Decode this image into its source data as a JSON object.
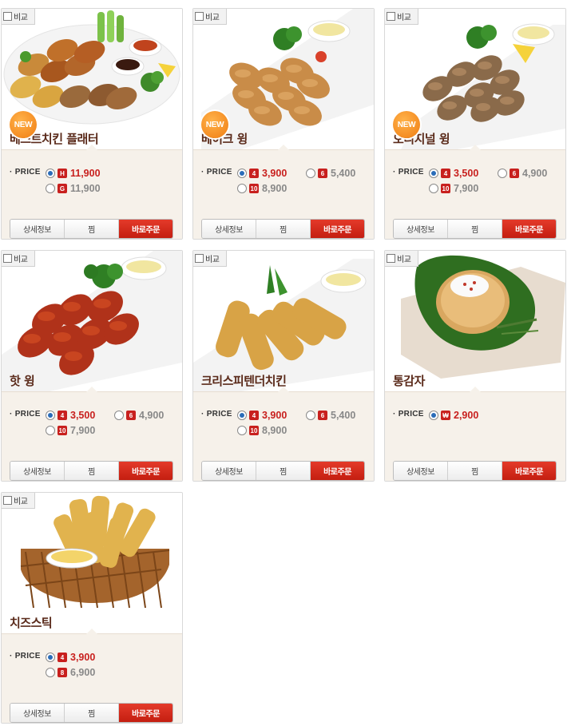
{
  "compare_label": "비교",
  "price_label": "· PRICE",
  "new_label": "NEW",
  "buttons": {
    "detail": "상세정보",
    "wish": "찜",
    "order": "바로주문"
  },
  "colors": {
    "accent": "#c8201e",
    "title": "#5a2a1a",
    "panel": "#f6f1ea",
    "new_badge": "#f07d12"
  },
  "products": [
    {
      "title": "베스트치킨 플래터",
      "is_new": true,
      "icon": "chicken-platter-photo",
      "options": [
        {
          "size": "H",
          "price": "11,900",
          "checked": true
        },
        {
          "size": "G",
          "price": "11,900",
          "checked": false
        }
      ]
    },
    {
      "title": "베이크 윙",
      "is_new": true,
      "icon": "baked-wings-photo",
      "options": [
        {
          "size": "4",
          "price": "3,900",
          "checked": true
        },
        {
          "size": "6",
          "price": "5,400",
          "checked": false
        },
        {
          "size": "10",
          "price": "8,900",
          "checked": false
        }
      ]
    },
    {
      "title": "오리지널 윙",
      "is_new": true,
      "icon": "original-wings-photo",
      "options": [
        {
          "size": "4",
          "price": "3,500",
          "checked": true
        },
        {
          "size": "6",
          "price": "4,900",
          "checked": false
        },
        {
          "size": "10",
          "price": "7,900",
          "checked": false
        }
      ]
    },
    {
      "title": "핫 윙",
      "is_new": false,
      "icon": "hot-wings-photo",
      "options": [
        {
          "size": "4",
          "price": "3,500",
          "checked": true
        },
        {
          "size": "6",
          "price": "4,900",
          "checked": false
        },
        {
          "size": "10",
          "price": "7,900",
          "checked": false
        }
      ]
    },
    {
      "title": "크리스피텐더치킨",
      "is_new": false,
      "icon": "crispy-tender-photo",
      "options": [
        {
          "size": "4",
          "price": "3,900",
          "checked": true
        },
        {
          "size": "6",
          "price": "5,400",
          "checked": false
        },
        {
          "size": "10",
          "price": "8,900",
          "checked": false
        }
      ]
    },
    {
      "title": "통감자",
      "is_new": false,
      "icon": "baked-potato-photo",
      "options": [
        {
          "size": "₩",
          "price": "2,900",
          "checked": true
        }
      ]
    },
    {
      "title": "치즈스틱",
      "is_new": false,
      "icon": "cheese-sticks-photo",
      "options": [
        {
          "size": "4",
          "price": "3,900",
          "checked": true
        },
        {
          "size": "8",
          "price": "6,900",
          "checked": false
        }
      ]
    }
  ]
}
